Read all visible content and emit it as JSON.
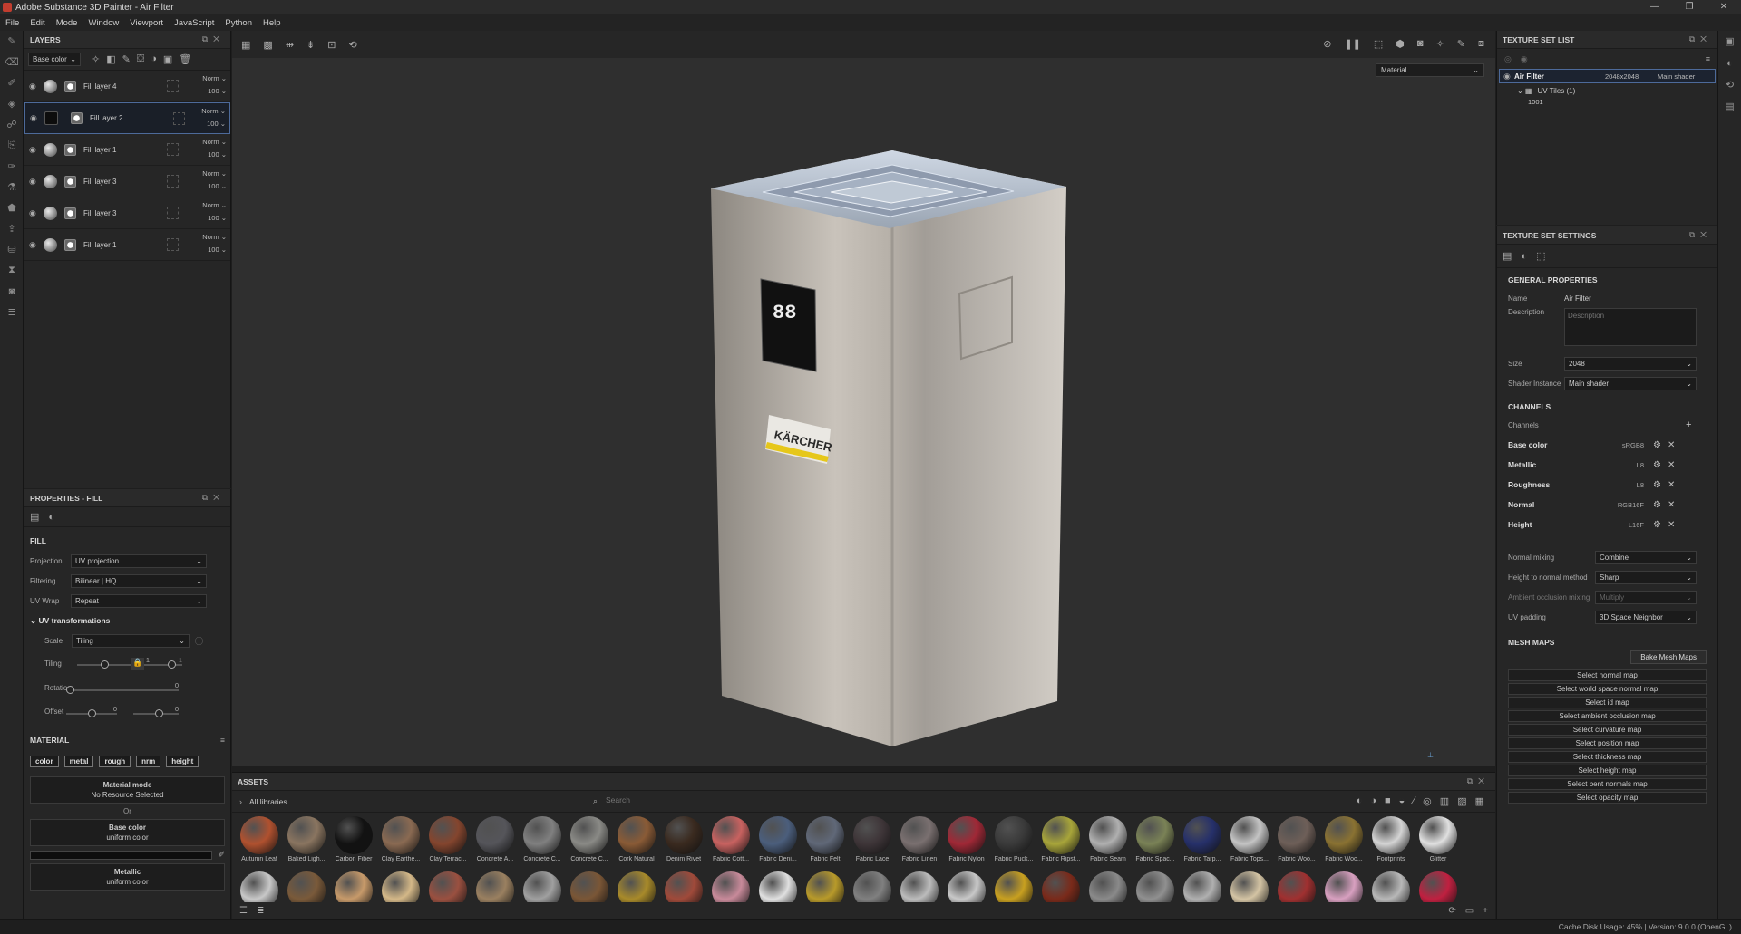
{
  "window": {
    "title": "Adobe Substance 3D Painter - Air Filter",
    "controls": [
      "—",
      "❐",
      "✕"
    ]
  },
  "menu": [
    "File",
    "Edit",
    "Mode",
    "Window",
    "Viewport",
    "JavaScript",
    "Python",
    "Help"
  ],
  "layers_panel": {
    "title": "LAYERS",
    "channel_select": "Base color",
    "items": [
      {
        "name": "Fill layer 4",
        "blend": "Norm",
        "opacity": "100"
      },
      {
        "name": "Fill layer 2",
        "blend": "Norm",
        "opacity": "100"
      },
      {
        "name": "Fill layer 1",
        "blend": "Norm",
        "opacity": "100"
      },
      {
        "name": "Fill layer 3",
        "blend": "Norm",
        "opacity": "100"
      },
      {
        "name": "Fill layer 3",
        "blend": "Norm",
        "opacity": "100"
      },
      {
        "name": "Fill layer 1",
        "blend": "Norm",
        "opacity": "100"
      }
    ]
  },
  "properties": {
    "title": "PROPERTIES - FILL",
    "fill_title": "FILL",
    "projection_label": "Projection",
    "projection": "UV projection",
    "filtering_label": "Filtering",
    "filtering": "Bilinear | HQ",
    "wrap_label": "UV Wrap",
    "wrap": "Repeat",
    "uvt_title": "UV transformations",
    "scale_label": "Scale",
    "scale": "Tiling",
    "tiling_label": "Tiling",
    "tiling_a": "1",
    "tiling_b": "1",
    "rotation_label": "Rotation",
    "rotation": "0",
    "offset_label": "Offset",
    "offset_a": "0",
    "offset_b": "0",
    "material_title": "MATERIAL",
    "chips": [
      "color",
      "metal",
      "rough",
      "nrm",
      "height"
    ],
    "material_mode": "Material mode",
    "no_resource": "No Resource Selected",
    "or": "Or",
    "base_color": "Base color",
    "uniform": "uniform color",
    "metallic": "Metallic",
    "uniform2": "uniform color"
  },
  "viewport": {
    "mode": "Material"
  },
  "assets": {
    "title": "ASSETS",
    "library": "All libraries",
    "search_placeholder": "Search",
    "row1": [
      {
        "name": "Autumn Leaf",
        "color": "#b0512f"
      },
      {
        "name": "Baked Ligh...",
        "color": "#8a7560"
      },
      {
        "name": "Carbon Fiber",
        "color": "#121212"
      },
      {
        "name": "Clay Earthe...",
        "color": "#8a6a52"
      },
      {
        "name": "Clay Terrac...",
        "color": "#84452e"
      },
      {
        "name": "Concrete A...",
        "color": "#55555a"
      },
      {
        "name": "Concrete C...",
        "color": "#808080"
      },
      {
        "name": "Concrete C...",
        "color": "#8a8a86"
      },
      {
        "name": "Cork Natural",
        "color": "#8a5b36"
      },
      {
        "name": "Denim Rivet",
        "color": "#3a2a1f"
      },
      {
        "name": "Fabric Cott...",
        "color": "#c86260"
      },
      {
        "name": "Fabric Deni...",
        "color": "#4b5e7c"
      },
      {
        "name": "Fabric Felt",
        "color": "#606878"
      },
      {
        "name": "Fabric Lace",
        "color": "#3e3538"
      },
      {
        "name": "Fabric Linen",
        "color": "#7a7070"
      },
      {
        "name": "Fabric Nylon",
        "color": "#a02836"
      },
      {
        "name": "Fabric Puck...",
        "color": "#3a3a3a"
      },
      {
        "name": "Fabric Ripst...",
        "color": "#a8a53a"
      },
      {
        "name": "Fabric Seam",
        "color": "#b0b0b0"
      },
      {
        "name": "Fabric Spac...",
        "color": "#7a8256"
      },
      {
        "name": "Fabric Tarp...",
        "color": "#26306a"
      },
      {
        "name": "Fabric Tops...",
        "color": "#c4c4c4"
      },
      {
        "name": "Fabric Woo...",
        "color": "#6e5f58"
      },
      {
        "name": "Fabric Woo...",
        "color": "#8a7232"
      },
      {
        "name": "Footprints",
        "color": "#d4d4d4"
      },
      {
        "name": "Glitter",
        "color": "#e0e0e0"
      }
    ],
    "row2": [
      "#c8c8c8",
      "#7a5a3a",
      "#c79a6a",
      "#d4b888",
      "#9a5040",
      "#9a8060",
      "#a0a0a0",
      "#7a5636",
      "#a88a2a",
      "#a04a3a",
      "#c88a9a",
      "#e0e0e0",
      "#b89a2a",
      "#808080",
      "#bcbcbc",
      "#c8c8c8",
      "#c8a020",
      "#7a2a1a",
      "#8a8a8a",
      "#909090",
      "#b0b0b0",
      "#d4c4a4",
      "#a03030",
      "#d8a0c0",
      "#b8b8b8",
      "#c02040"
    ]
  },
  "texture_set_list": {
    "title": "TEXTURE SET LIST",
    "set_name": "Air Filter",
    "resolution": "2048x2048",
    "shader": "Main shader",
    "uv_tiles": "UV Tiles (1)",
    "tile": "1001"
  },
  "texture_set_settings": {
    "title": "TEXTURE SET SETTINGS",
    "general": "GENERAL PROPERTIES",
    "name_label": "Name",
    "name": "Air Filter",
    "desc_label": "Description",
    "desc_placeholder": "Description",
    "size_label": "Size",
    "size": "2048",
    "shader_label": "Shader Instance",
    "shader": "Main shader",
    "channels_title": "CHANNELS",
    "channels_label": "Channels",
    "channels": [
      {
        "name": "Base color",
        "format": "sRGB8"
      },
      {
        "name": "Metallic",
        "format": "L8"
      },
      {
        "name": "Roughness",
        "format": "L8"
      },
      {
        "name": "Normal",
        "format": "RGB16F"
      },
      {
        "name": "Height",
        "format": "L16F"
      }
    ],
    "normal_mixing_label": "Normal mixing",
    "normal_mixing": "Combine",
    "htn_label": "Height to normal method",
    "htn": "Sharp",
    "ao_label": "Ambient occlusion mixing",
    "ao": "Multiply",
    "uvpad_label": "UV padding",
    "uvpad": "3D Space Neighbor",
    "mesh_maps_title": "MESH MAPS",
    "bake": "Bake Mesh Maps",
    "mesh_maps": [
      "Select normal map",
      "Select world space normal map",
      "Select id map",
      "Select ambient occlusion map",
      "Select curvature map",
      "Select position map",
      "Select thickness map",
      "Select height map",
      "Select bent normals map",
      "Select opacity map"
    ]
  },
  "status": "Cache Disk Usage:    45% | Version: 9.0.0 (OpenGL)",
  "product_label": "KÄRCHER",
  "display_digits": "88"
}
